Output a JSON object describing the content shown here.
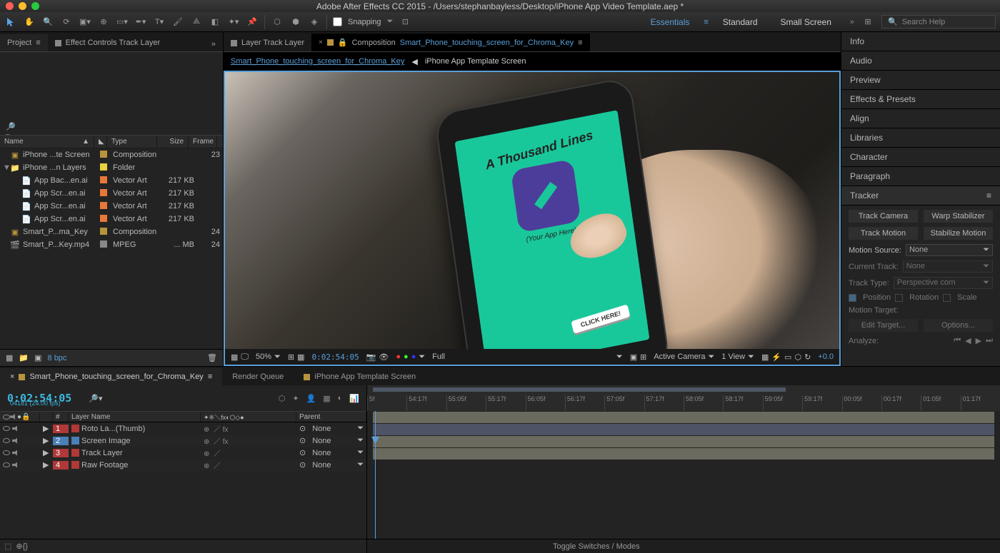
{
  "title": "Adobe After Effects CC 2015 - /Users/stephanbayless/Desktop/iPhone App Video Template.aep *",
  "snapping": "Snapping",
  "workspaces": [
    "Essentials",
    "Standard",
    "Small Screen"
  ],
  "searchPlaceholder": "Search Help",
  "leftTabs": {
    "project": "Project",
    "effectControls": "Effect Controls Track Layer"
  },
  "centerTabs": {
    "layerTrack": "Layer Track Layer",
    "composition": "Composition",
    "compName": "Smart_Phone_touching_screen_for_Chroma_Key"
  },
  "breadcrumb1": "Smart_Phone_touching_screen_for_Chroma_Key",
  "breadcrumb2": "iPhone App Template Screen",
  "projCols": {
    "name": "Name",
    "type": "Type",
    "size": "Size",
    "frame": "Frame"
  },
  "projItems": [
    {
      "i": 0,
      "name": "iPhone ...te Screen",
      "type": "Composition",
      "size": "",
      "frame": "23",
      "ic": "comp"
    },
    {
      "i": 0,
      "name": "iPhone ...n Layers",
      "type": "Folder",
      "size": "",
      "frame": "",
      "ic": "fold",
      "arrow": "▼"
    },
    {
      "i": 1,
      "name": "App Bac...en.ai",
      "type": "Vector Art",
      "size": "217 KB",
      "frame": "",
      "ic": "ai"
    },
    {
      "i": 1,
      "name": "App Scr...en.ai",
      "type": "Vector Art",
      "size": "217 KB",
      "frame": "",
      "ic": "ai"
    },
    {
      "i": 1,
      "name": "App Scr...en.ai",
      "type": "Vector Art",
      "size": "217 KB",
      "frame": "",
      "ic": "ai"
    },
    {
      "i": 1,
      "name": "App Scr...en.ai",
      "type": "Vector Art",
      "size": "217 KB",
      "frame": "",
      "ic": "ai"
    },
    {
      "i": 0,
      "name": "Smart_P...ma_Key",
      "type": "Composition",
      "size": "",
      "frame": "24",
      "ic": "comp"
    },
    {
      "i": 0,
      "name": "Smart_P...Key.mp4",
      "type": "MPEG",
      "size": "... MB",
      "frame": "24",
      "ic": "mov"
    }
  ],
  "bpc": "8 bpc",
  "viewFoot": {
    "zoom": "50%",
    "time": "0:02:54:05",
    "res": "Full",
    "camera": "Active Camera",
    "view": "1 View",
    "exp": "+0.0"
  },
  "rightPanels": [
    "Info",
    "Audio",
    "Preview",
    "Effects & Presets",
    "Align",
    "Libraries",
    "Character",
    "Paragraph"
  ],
  "tracker": {
    "title": "Tracker",
    "trackCamera": "Track Camera",
    "warp": "Warp Stabilizer",
    "trackMotion": "Track Motion",
    "stab": "Stabilize Motion",
    "ms": "Motion Source:",
    "msv": "None",
    "ct": "Current Track:",
    "ctv": "None",
    "tt": "Track Type:",
    "ttv": "Perspective corn",
    "position": "Position",
    "rotation": "Rotation",
    "scale": "Scale",
    "mt": "Motion Target:",
    "edit": "Edit Target...",
    "options": "Options...",
    "analyze": "Analyze:"
  },
  "btabs": {
    "t1": "Smart_Phone_touching_screen_for_Chroma_Key",
    "t2": "Render Queue",
    "t3": "iPhone App Template Screen"
  },
  "timecode": "0:02:54:05",
  "fps": "04181 (24.00 fps)",
  "layHdr": {
    "num": "#",
    "name": "Layer Name",
    "parent": "Parent"
  },
  "layers": [
    {
      "n": "1",
      "name": "Roto La...(Thumb)",
      "ic": "a",
      "parent": "None"
    },
    {
      "n": "2",
      "name": "Screen Image",
      "ic": "b",
      "parent": "None"
    },
    {
      "n": "3",
      "name": "Track Layer",
      "ic": "a",
      "parent": "None"
    },
    {
      "n": "4",
      "name": "Raw Footage",
      "ic": "a",
      "parent": "None"
    }
  ],
  "toggleModes": "Toggle Switches / Modes",
  "timeMarks": [
    "5f",
    "54:17f",
    "55:05f",
    "55:17f",
    "56:05f",
    "56:17f",
    "57:05f",
    "57:17f",
    "58:05f",
    "58:17f",
    "59:05f",
    "59:17f",
    "00:05f",
    "00:17f",
    "01:05f",
    "01:17f"
  ],
  "phone": {
    "title": "A Thousand Lines",
    "sub": "(Your App Here)",
    "btn": "CLICK HERE!"
  }
}
